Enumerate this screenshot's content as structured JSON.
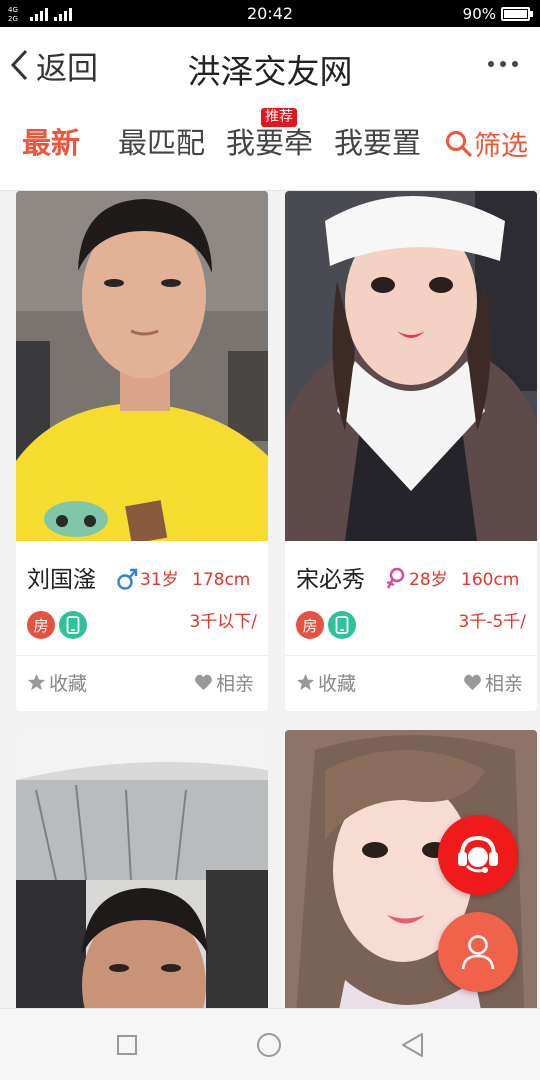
{
  "status_bar": {
    "network_top": "4G",
    "network_bottom": "2G",
    "time": "20:42",
    "battery_text": "90%",
    "battery_level": 0.9
  },
  "header": {
    "back_label": "返回",
    "title": "洪泽交友网",
    "more_icon": "more-dots-icon"
  },
  "tabs": {
    "items": [
      {
        "label": "最新",
        "active": true
      },
      {
        "label": "最匹配",
        "active": false
      },
      {
        "label": "我要牵",
        "active": false
      },
      {
        "label": "我要置",
        "active": false
      }
    ],
    "badge": "推荐",
    "filter_label": "筛选",
    "filter_icon": "search-icon"
  },
  "cards": [
    {
      "name": "刘国滏",
      "gender": "male",
      "gender_icon": "male-icon",
      "age": "31岁",
      "height": "178cm",
      "tag_house": "房",
      "tag_phone_icon": "phone-icon",
      "income": "3千以下/",
      "collect_label": "收藏",
      "date_label": "相亲"
    },
    {
      "name": "宋必秀",
      "gender": "female",
      "gender_icon": "female-icon",
      "age": "28岁",
      "height": "160cm",
      "tag_house": "房",
      "tag_phone_icon": "phone-icon",
      "income": "3千-5千/",
      "collect_label": "收藏",
      "date_label": "相亲"
    },
    {
      "photo_only": true
    },
    {
      "photo_only": true
    }
  ],
  "colors": {
    "accent": "#f0553a",
    "price_red": "#e8342a",
    "badge_red": "#e8141b",
    "male_blue": "#2a82e4",
    "female_pink": "#e0439b",
    "phone_green": "#2ec19b",
    "fab_service": "#f01a1a",
    "fab_profile": "#f0624a"
  },
  "floating": {
    "service_icon": "customer-service-icon",
    "profile_icon": "user-icon"
  },
  "nav": {
    "recent_icon": "square-icon",
    "home_icon": "circle-icon",
    "back_icon": "triangle-back-icon"
  }
}
